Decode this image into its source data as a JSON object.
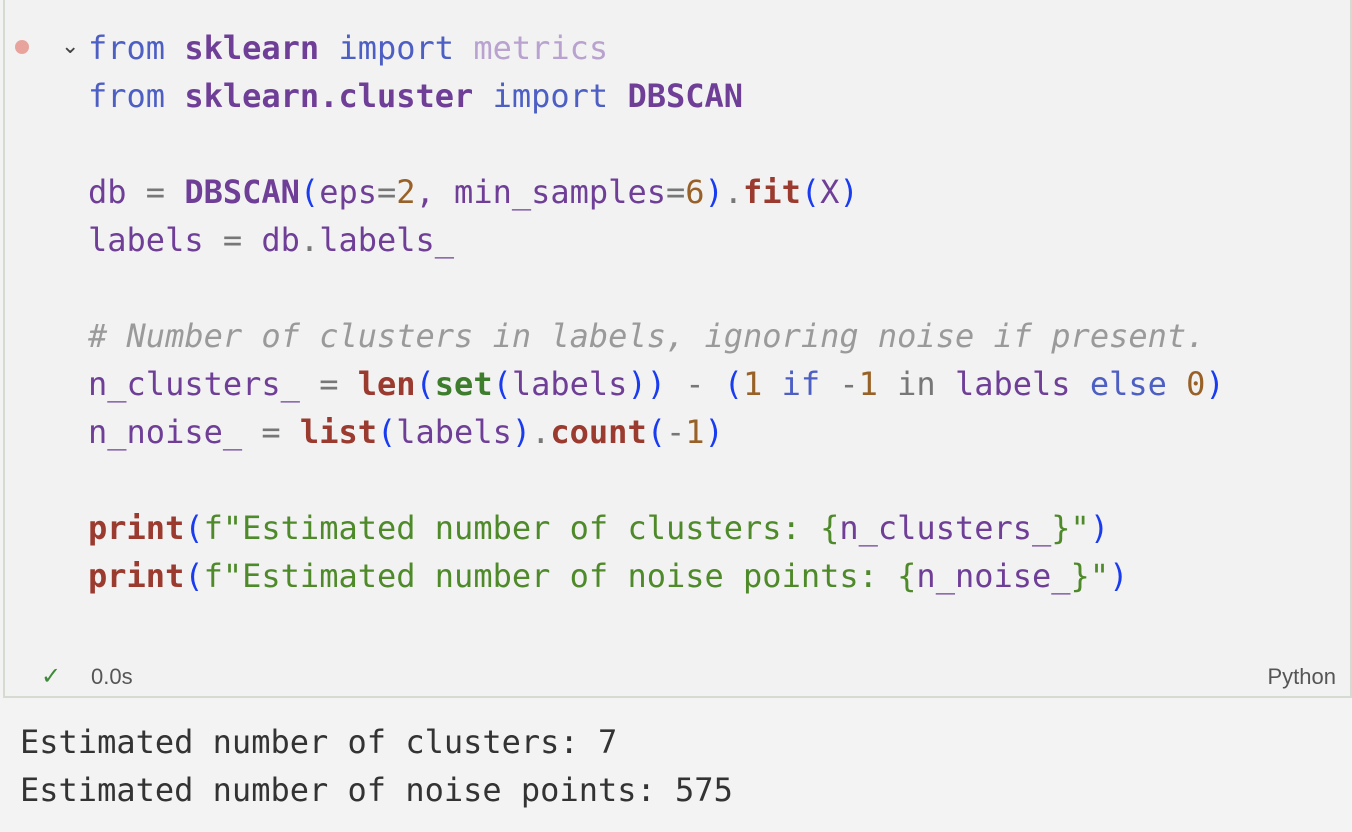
{
  "cell": {
    "lines": [
      [
        [
          "kw",
          "from "
        ],
        [
          "mod",
          "sklearn"
        ],
        [
          "kw",
          " import "
        ],
        [
          "faded",
          "metrics"
        ]
      ],
      [
        [
          "kw",
          "from "
        ],
        [
          "mod",
          "sklearn.cluster"
        ],
        [
          "kw",
          " import "
        ],
        [
          "mod",
          "DBSCAN"
        ]
      ],
      [],
      [
        [
          "var",
          "db "
        ],
        [
          "op",
          "= "
        ],
        [
          "mod",
          "DBSCAN"
        ],
        [
          "par",
          "("
        ],
        [
          "var",
          "eps"
        ],
        [
          "op",
          "="
        ],
        [
          "num",
          "2"
        ],
        [
          "var",
          ", min_samples"
        ],
        [
          "op",
          "="
        ],
        [
          "num",
          "6"
        ],
        [
          "par",
          ")"
        ],
        [
          "op",
          "."
        ],
        [
          "fn",
          "fit"
        ],
        [
          "par",
          "("
        ],
        [
          "var",
          "X"
        ],
        [
          "par",
          ")"
        ]
      ],
      [
        [
          "var",
          "labels "
        ],
        [
          "op",
          "= "
        ],
        [
          "var",
          "db"
        ],
        [
          "op",
          "."
        ],
        [
          "var",
          "labels_"
        ]
      ],
      [],
      [
        [
          "com",
          "# Number of clusters in labels, ignoring noise if present."
        ]
      ],
      [
        [
          "var",
          "n_clusters_ "
        ],
        [
          "op",
          "= "
        ],
        [
          "fn",
          "len"
        ],
        [
          "par",
          "("
        ],
        [
          "bi",
          "set"
        ],
        [
          "par",
          "("
        ],
        [
          "var",
          "labels"
        ],
        [
          "par",
          "))"
        ],
        [
          "op",
          " - "
        ],
        [
          "par",
          "("
        ],
        [
          "num",
          "1"
        ],
        [
          "kw",
          " if "
        ],
        [
          "op",
          "-"
        ],
        [
          "num",
          "1"
        ],
        [
          "op",
          " in "
        ],
        [
          "var",
          "labels"
        ],
        [
          "kw",
          " else "
        ],
        [
          "num",
          "0"
        ],
        [
          "par",
          ")"
        ]
      ],
      [
        [
          "var",
          "n_noise_ "
        ],
        [
          "op",
          "= "
        ],
        [
          "fn",
          "list"
        ],
        [
          "par",
          "("
        ],
        [
          "var",
          "labels"
        ],
        [
          "par",
          ")"
        ],
        [
          "op",
          "."
        ],
        [
          "fn",
          "count"
        ],
        [
          "par",
          "("
        ],
        [
          "op",
          "-"
        ],
        [
          "num",
          "1"
        ],
        [
          "par",
          ")"
        ]
      ],
      [],
      [
        [
          "fn",
          "print"
        ],
        [
          "par",
          "("
        ],
        [
          "str",
          "f\"Estimated number of clusters: "
        ],
        [
          "str",
          "{"
        ],
        [
          "var",
          "n_clusters_"
        ],
        [
          "str",
          "}\""
        ],
        [
          "par",
          ")"
        ]
      ],
      [
        [
          "fn",
          "print"
        ],
        [
          "par",
          "("
        ],
        [
          "str",
          "f\"Estimated number of noise points: "
        ],
        [
          "str",
          "{"
        ],
        [
          "var",
          "n_noise_"
        ],
        [
          "str",
          "}\""
        ],
        [
          "par",
          ")"
        ]
      ]
    ],
    "exec_time": "0.0s",
    "language": "Python"
  },
  "output": [
    "Estimated number of clusters: 7",
    "Estimated number of noise points: 575"
  ]
}
